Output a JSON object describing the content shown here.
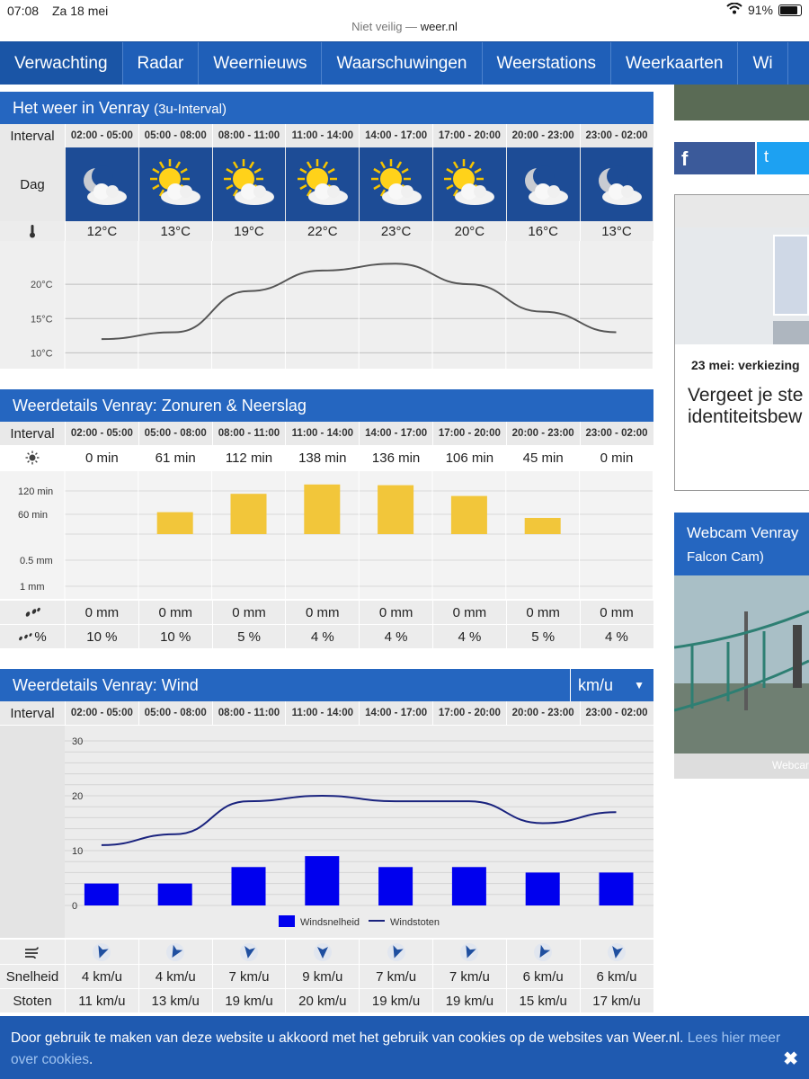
{
  "status": {
    "time": "07:08",
    "date": "Za 18 mei",
    "battery": "91%",
    "battery_level": 0.91
  },
  "url": {
    "prefix": "Niet veilig —",
    "domain": "weer.nl"
  },
  "nav": [
    "Verwachting",
    "Radar",
    "Weernieuws",
    "Waarschuwingen",
    "Weerstations",
    "Weerkaarten",
    "Wi"
  ],
  "intervals": [
    "02:00 - 05:00",
    "05:00 - 08:00",
    "08:00 - 11:00",
    "11:00 - 14:00",
    "14:00 - 17:00",
    "17:00 - 20:00",
    "20:00 - 23:00",
    "23:00 - 02:00"
  ],
  "labels": {
    "interval": "Interval",
    "dag": "Dag",
    "snelheid": "Snelheid",
    "stoten": "Stoten"
  },
  "weather": {
    "title": "Het weer in Venray",
    "subtitle": "(3u-Interval)",
    "icons": [
      "moon-cloud-icon",
      "sun-cloud-icon",
      "sun-cloud-icon",
      "sun-cloud-icon",
      "sun-cloud-icon",
      "sun-cloud-icon",
      "moon-cloud-icon",
      "moon-cloud-icon"
    ],
    "temps": [
      "12°C",
      "13°C",
      "19°C",
      "22°C",
      "23°C",
      "20°C",
      "16°C",
      "13°C"
    ]
  },
  "details": {
    "title": "Weerdetails Venray: Zonuren & Neerslag",
    "sun": [
      "0 min",
      "61 min",
      "112 min",
      "138 min",
      "136 min",
      "106 min",
      "45 min",
      "0 min"
    ],
    "rain": [
      "0 mm",
      "0 mm",
      "0 mm",
      "0 mm",
      "0 mm",
      "0 mm",
      "0 mm",
      "0 mm"
    ],
    "rain_pct": [
      "10 %",
      "10 %",
      "5 %",
      "4 %",
      "4 %",
      "4 %",
      "5 %",
      "4 %"
    ],
    "rain_pct_label": "%"
  },
  "wind": {
    "title": "Weerdetails Venray: Wind",
    "unit": "km/u",
    "speed": [
      "4 km/u",
      "4 km/u",
      "7 km/u",
      "9 km/u",
      "7 km/u",
      "7 km/u",
      "6 km/u",
      "6 km/u"
    ],
    "gusts": [
      "11 km/u",
      "13 km/u",
      "19 km/u",
      "20 km/u",
      "19 km/u",
      "19 km/u",
      "15 km/u",
      "17 km/u"
    ],
    "direction_deg": [
      20,
      30,
      10,
      0,
      20,
      20,
      30,
      10
    ]
  },
  "chart_data": [
    {
      "type": "line",
      "categories": [
        "02:00 - 05:00",
        "05:00 - 08:00",
        "08:00 - 11:00",
        "11:00 - 14:00",
        "14:00 - 17:00",
        "17:00 - 20:00",
        "20:00 - 23:00",
        "23:00 - 02:00"
      ],
      "values": [
        12,
        13,
        19,
        22,
        23,
        20,
        16,
        13
      ],
      "ylabels": [
        "20°C",
        "15°C",
        "10°C"
      ],
      "ylim": [
        9,
        25
      ]
    },
    {
      "type": "bar",
      "categories": [
        "02:00 - 05:00",
        "05:00 - 08:00",
        "08:00 - 11:00",
        "11:00 - 14:00",
        "14:00 - 17:00",
        "17:00 - 20:00",
        "20:00 - 23:00",
        "23:00 - 02:00"
      ],
      "values": [
        0,
        61,
        112,
        138,
        136,
        106,
        45,
        0
      ],
      "ylabels_top": [
        "120 min",
        "60 min"
      ],
      "ylabels_bottom": [
        "0.5 mm",
        "1 mm"
      ],
      "color": "#f2c63a"
    },
    {
      "type": "bar+line",
      "categories": [
        "02:00 - 05:00",
        "05:00 - 08:00",
        "08:00 - 11:00",
        "11:00 - 14:00",
        "14:00 - 17:00",
        "17:00 - 20:00",
        "20:00 - 23:00",
        "23:00 - 02:00"
      ],
      "series": [
        {
          "name": "Windsnelheid",
          "values": [
            4,
            4,
            7,
            9,
            7,
            7,
            6,
            6
          ],
          "color": "#0000ee"
        },
        {
          "name": "Windstoten",
          "values": [
            11,
            13,
            19,
            20,
            19,
            19,
            15,
            17
          ],
          "color": "#1a237e"
        }
      ],
      "yticks": [
        "30",
        "20",
        "10",
        "0"
      ],
      "ylim": [
        0,
        30
      ]
    }
  ],
  "sidebar": {
    "facebook": "f",
    "twitter": "t",
    "news_caption": "23 mei: verkiezing",
    "news_headline_1": "Vergeet je ste",
    "news_headline_2": "identiteitsbew",
    "webcam_title": "Webcam Venray",
    "webcam_sub": "Falcon Cam)",
    "webcam_foot": "Webcar"
  },
  "cookie": {
    "text": "Door gebruik te maken van deze website u akkoord met het gebruik van cookies op de websites van Weer.nl.",
    "link": "Lees hier meer over cookies",
    "close": "✖"
  }
}
